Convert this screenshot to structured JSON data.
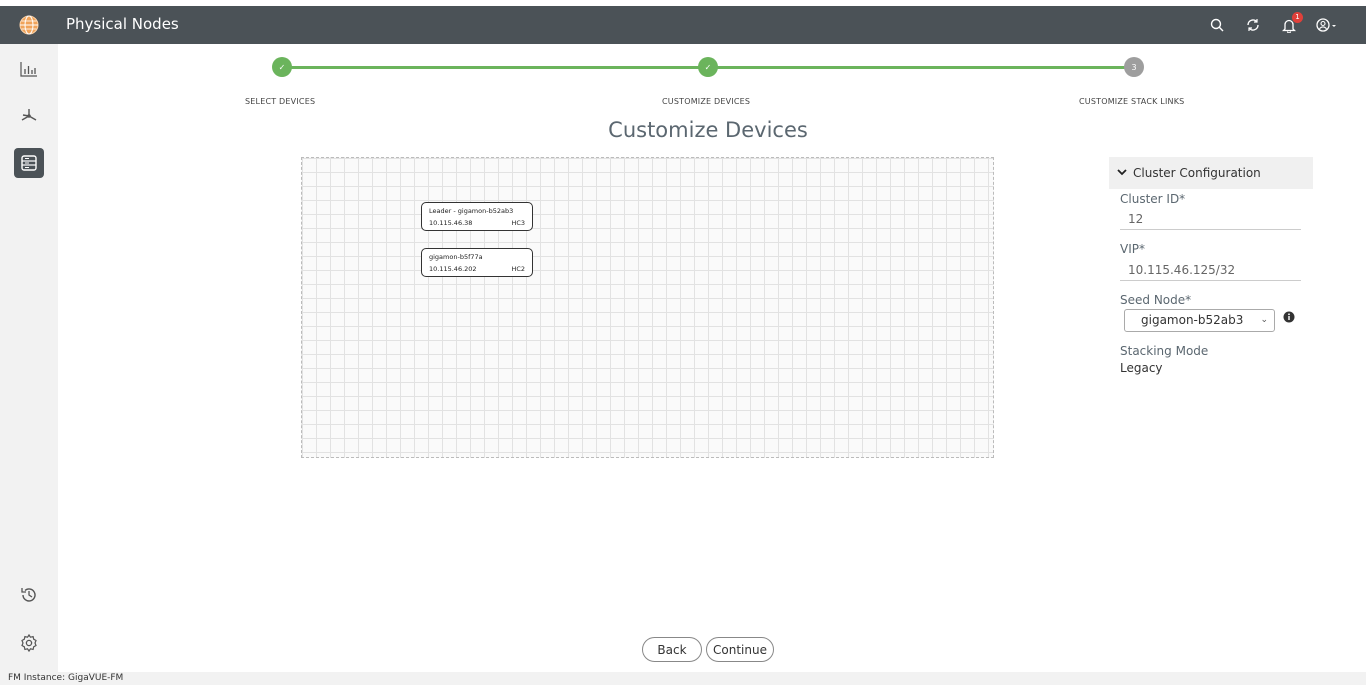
{
  "header": {
    "title": "Physical Nodes",
    "notification_count": "1",
    "icons": [
      "globe-icon",
      "search-icon",
      "refresh-icon",
      "bell-icon",
      "user-icon"
    ]
  },
  "sidebar": {
    "items": [
      {
        "name": "dashboard",
        "icon": "bar-chart-icon",
        "active": false
      },
      {
        "name": "topology",
        "icon": "network-icon",
        "active": false
      },
      {
        "name": "physical",
        "icon": "server-icon",
        "active": true
      }
    ],
    "bottom_items": [
      {
        "name": "history",
        "icon": "history-icon"
      },
      {
        "name": "settings",
        "icon": "gear-icon"
      }
    ]
  },
  "stepper": {
    "steps": [
      {
        "label": "SELECT DEVICES",
        "marker": "✓",
        "state": "done"
      },
      {
        "label": "CUSTOMIZE DEVICES",
        "marker": "✓",
        "state": "done"
      },
      {
        "label": "CUSTOMIZE STACK LINKS",
        "marker": "3",
        "state": "pending"
      }
    ]
  },
  "page_title": "Customize Devices",
  "devices": [
    {
      "name": "Leader - gigamon-b52ab3",
      "ip": "10.115.46.38",
      "model": "HC3"
    },
    {
      "name": "gigamon-b5f77a",
      "ip": "10.115.46.202",
      "model": "HC2"
    }
  ],
  "panel": {
    "header": "Cluster Configuration",
    "cluster_id_label": "Cluster ID*",
    "cluster_id_value": "12",
    "vip_label": "VIP*",
    "vip_value": "10.115.46.125/32",
    "seed_node_label": "Seed Node*",
    "seed_node_value": "gigamon-b52ab3",
    "stacking_mode_label": "Stacking Mode",
    "stacking_mode_value": "Legacy"
  },
  "buttons": {
    "back": "Back",
    "continue": "Continue"
  },
  "footer": {
    "instance_label": "FM Instance:",
    "instance_value": "GigaVUE-FM"
  },
  "colors": {
    "header_bg": "#4b5257",
    "step_done": "#6bb45c",
    "step_pending": "#9e9e9e",
    "badge": "#e0403a"
  }
}
